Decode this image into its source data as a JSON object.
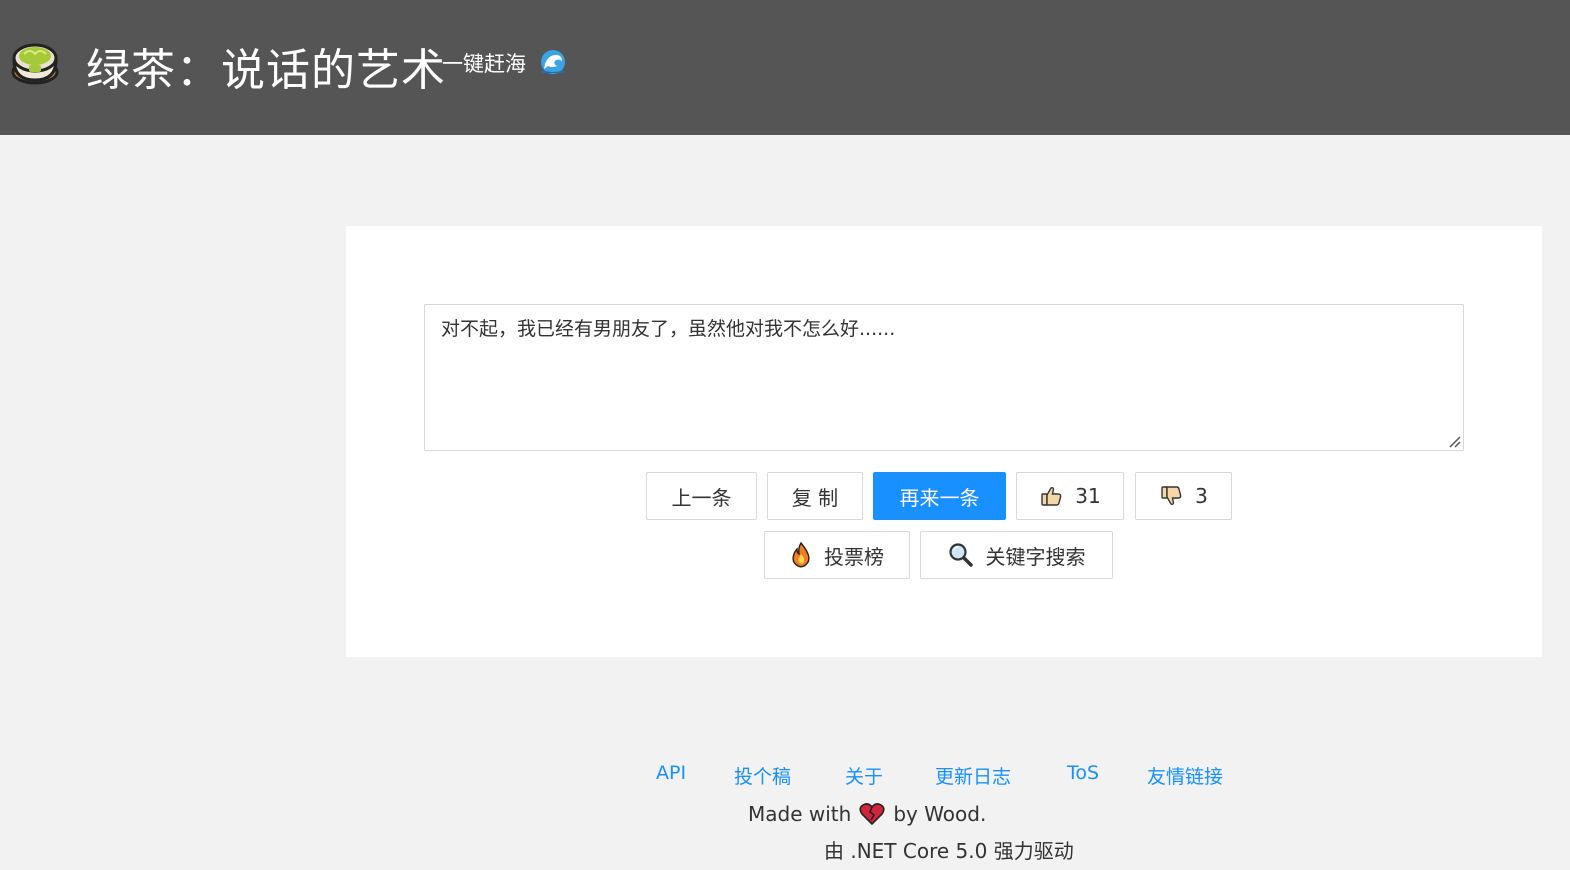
{
  "header": {
    "logo_icon": "green-tea-bowl-icon",
    "title": "绿茶：说话的艺术",
    "subtitle": "一键赶海",
    "subtitle_icon": "wave-icon"
  },
  "quote": {
    "text": "对不起，我已经有男朋友了，虽然他对我不怎么好......"
  },
  "actions": {
    "prev_label": "上一条",
    "copy_label": "复 制",
    "next_label": "再来一条",
    "like_count": "31",
    "like_icon": "thumbs-up-icon",
    "dislike_count": "3",
    "dislike_icon": "thumbs-down-icon",
    "rank_label": "投票榜",
    "rank_icon": "fire-icon",
    "search_label": "关键字搜索",
    "search_icon": "magnifier-icon"
  },
  "footer": {
    "links": [
      "API",
      "投个稿",
      "关于",
      "更新日志",
      "ToS",
      "友情链接"
    ],
    "made_with_prefix": "Made with",
    "made_with_icon": "broken-heart-icon",
    "made_with_suffix": "by Wood.",
    "powered_by": "由 .NET Core 5.0 强力驱动"
  },
  "colors": {
    "header_bg": "#555555",
    "page_bg": "#f2f2f2",
    "primary": "#1890ff"
  }
}
